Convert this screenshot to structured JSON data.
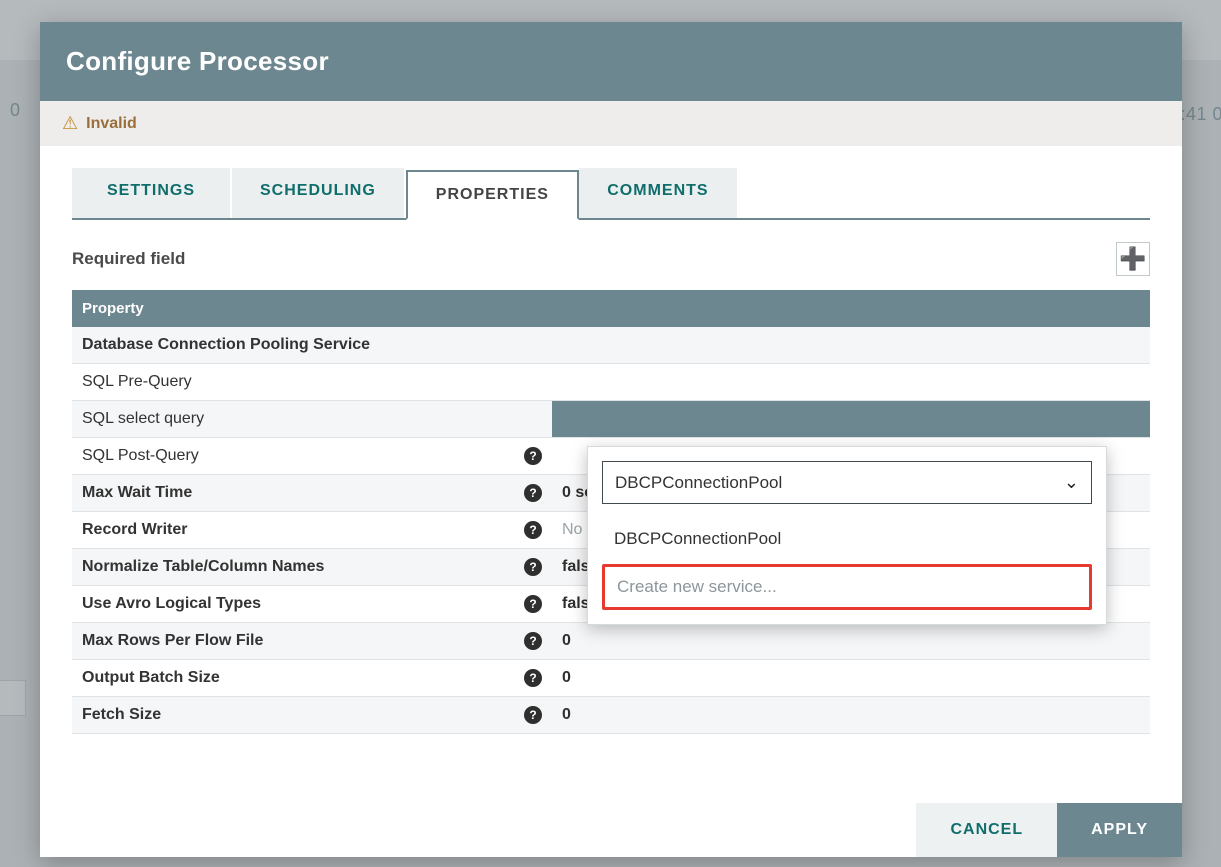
{
  "background": {
    "left_number": "0",
    "right_time_fragment": ":41 0"
  },
  "dialog": {
    "title": "Configure Processor",
    "status": "Invalid",
    "tabs": [
      "SETTINGS",
      "SCHEDULING",
      "PROPERTIES",
      "COMMENTS"
    ],
    "active_tab_index": 2,
    "required_label": "Required field",
    "columns": {
      "name": "Property",
      "value": ""
    },
    "footer": {
      "cancel": "CANCEL",
      "apply": "APPLY"
    }
  },
  "editor": {
    "selected": "DBCPConnectionPool",
    "options": [
      "DBCPConnectionPool"
    ],
    "create_label": "Create new service..."
  },
  "properties": [
    {
      "name": "Database Connection Pooling Service",
      "bold": true,
      "help": false,
      "value": "",
      "value_mode": "editor"
    },
    {
      "name": "SQL Pre-Query",
      "bold": false,
      "help": false,
      "value": "",
      "value_mode": "empty"
    },
    {
      "name": "SQL select query",
      "bold": false,
      "help": false,
      "value": "",
      "value_mode": "selected"
    },
    {
      "name": "SQL Post-Query",
      "bold": false,
      "help": true,
      "value": "",
      "value_mode": "empty"
    },
    {
      "name": "Max Wait Time",
      "bold": true,
      "help": true,
      "value": "0 seconds",
      "value_mode": "bold"
    },
    {
      "name": "Record Writer",
      "bold": true,
      "help": true,
      "value": "No value set",
      "value_mode": "placeholder"
    },
    {
      "name": "Normalize Table/Column Names",
      "bold": true,
      "help": true,
      "value": "false",
      "value_mode": "bold"
    },
    {
      "name": "Use Avro Logical Types",
      "bold": true,
      "help": true,
      "value": "false",
      "value_mode": "bold"
    },
    {
      "name": "Max Rows Per Flow File",
      "bold": true,
      "help": true,
      "value": "0",
      "value_mode": "bold"
    },
    {
      "name": "Output Batch Size",
      "bold": true,
      "help": true,
      "value": "0",
      "value_mode": "bold"
    },
    {
      "name": "Fetch Size",
      "bold": true,
      "help": true,
      "value": "0",
      "value_mode": "bold"
    }
  ]
}
